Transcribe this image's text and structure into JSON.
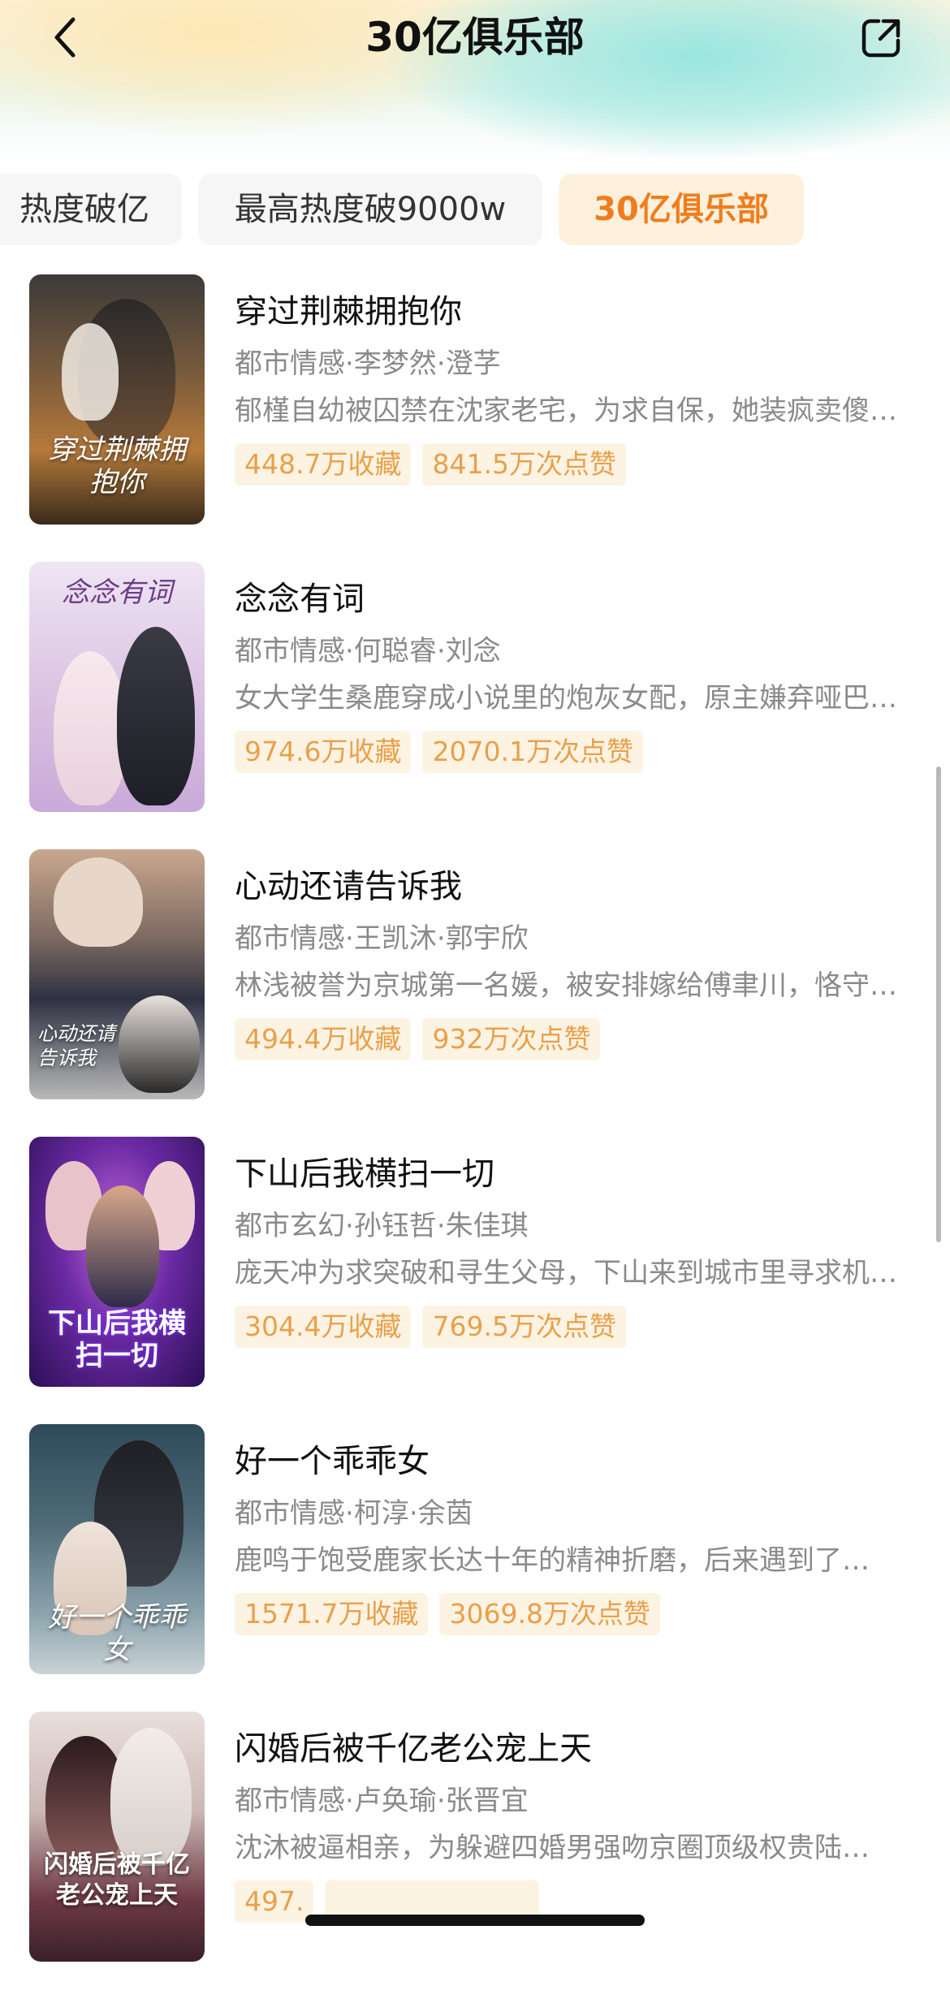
{
  "header": {
    "title": "30亿俱乐部",
    "back_icon": "chevron-left-icon",
    "share_icon": "share-icon"
  },
  "tabs": [
    {
      "label": "热度破亿",
      "selected": false
    },
    {
      "label": "最高热度破9000w",
      "selected": false
    },
    {
      "label": "30亿俱乐部",
      "selected": true
    }
  ],
  "colors": {
    "accent": "#f07d1d",
    "tag_text": "#e9a04a",
    "tag_bg": "#fdf3e3",
    "secondary_text": "#8a8a8a"
  },
  "items": [
    {
      "title": "穿过荆棘拥抱你",
      "genre": "都市情感",
      "actor1": "李梦然",
      "actor2": "澄芓",
      "description": "郁槿自幼被囚禁在沈家老宅，为求自保，她装疯卖傻…",
      "favorites": "448.7万收藏",
      "likes": "841.5万次点赞",
      "poster_text": "穿过荆棘拥抱你"
    },
    {
      "title": "念念有词",
      "genre": "都市情感",
      "actor1": "何聪睿",
      "actor2": "刘念",
      "description": "女大学生桑鹿穿成小说里的炮灰女配，原主嫌弃哑巴…",
      "favorites": "974.6万收藏",
      "likes": "2070.1万次点赞",
      "poster_text": "念念有词"
    },
    {
      "title": "心动还请告诉我",
      "genre": "都市情感",
      "actor1": "王凯沐",
      "actor2": "郭宇欣",
      "description": "林浅被誉为京城第一名媛，被安排嫁给傅聿川，恪守…",
      "favorites": "494.4万收藏",
      "likes": "932万次点赞",
      "poster_text": "心动还请告诉我"
    },
    {
      "title": "下山后我横扫一切",
      "genre": "都市玄幻",
      "actor1": "孙钰哲",
      "actor2": "朱佳琪",
      "description": "庞天冲为求突破和寻生父母，下山来到城市里寻求机…",
      "favorites": "304.4万收藏",
      "likes": "769.5万次点赞",
      "poster_text": "下山后我横扫一切"
    },
    {
      "title": "好一个乖乖女",
      "genre": "都市情感",
      "actor1": "柯淳",
      "actor2": "余茵",
      "description": "鹿鸣于饱受鹿家长达十年的精神折磨，后来遇到了…",
      "favorites": "1571.7万收藏",
      "likes": "3069.8万次点赞",
      "poster_text": "好一个乖乖女"
    },
    {
      "title": "闪婚后被千亿老公宠上天",
      "genre": "都市情感",
      "actor1": "卢奂瑜",
      "actor2": "张晋宜",
      "description": "沈沐被逼相亲，为躲避四婚男强吻京圈顶级权贵陆…",
      "favorites": "497.",
      "likes": "",
      "poster_text": "闪婚后被千亿老公宠上天"
    }
  ]
}
